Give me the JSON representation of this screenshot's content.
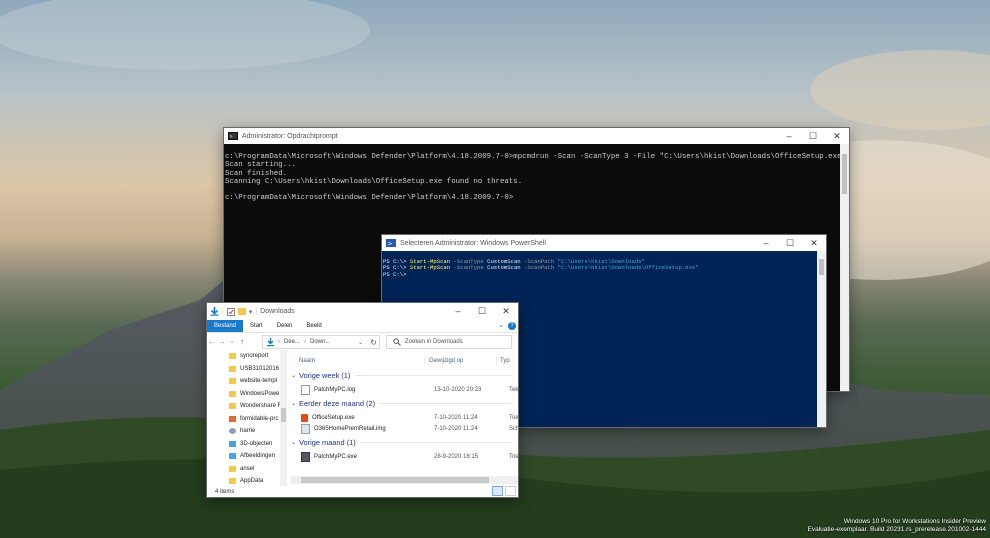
{
  "desktop": {
    "watermark_line1": "Windows 10 Pro for Workstations Insider Preview",
    "watermark_line2": "Evaluatie-exemplaar. Build 20231.rs_prerelease.201002-1444"
  },
  "cmd": {
    "title": "Administrator: Opdrachtprompt",
    "lines": [
      "c:\\ProgramData\\Microsoft\\Windows Defender\\Platform\\4.18.2009.7-0>mpcmdrun -Scan -ScanType 3 -File \"C:\\Users\\hkist\\Downloads\\OfficeSetup.exe\"",
      "Scan starting...",
      "Scan finished.",
      "Scanning C:\\Users\\hkist\\Downloads\\OfficeSetup.exe found no threats.",
      "",
      "c:\\ProgramData\\Microsoft\\Windows Defender\\Platform\\4.18.2009.7-0>"
    ]
  },
  "powershell": {
    "title": "Selecteren Administrator: Windows PowerShell",
    "prompt": "PS C:\\> ",
    "line1": {
      "cmd": "Start-MpScan",
      "p1": " -ScanType ",
      "v1": "CustomScan",
      "p2": " -ScanPath ",
      "path": "\"C:\\Users\\hkist\\Downloads\""
    },
    "line2": {
      "cmd": "Start-MpScan",
      "p1": " -ScanType ",
      "v1": "CustomScan",
      "p2": " -ScanPath ",
      "path": "\"C:\\Users\\hkist\\Downloads\\OfficeSetup.exe\""
    },
    "line3": "PS C:\\>"
  },
  "explorer": {
    "title": "Downloads",
    "ribbon_tabs": [
      "Bestand",
      "Start",
      "Delen",
      "Beeld"
    ],
    "address": [
      "Dee...",
      "Down..."
    ],
    "search_placeholder": "Zoeken in Downloads",
    "nav_items": [
      {
        "label": "synoreport",
        "icon": "folder-icon"
      },
      {
        "label": "USB31012016",
        "icon": "folder-icon"
      },
      {
        "label": "website-templ",
        "icon": "folder-icon"
      },
      {
        "label": "WindowsPowe",
        "icon": "folder-icon"
      },
      {
        "label": "Wondershare F",
        "icon": "folder-icon"
      },
      {
        "label": "formidable-prc",
        "icon": "file-icon"
      },
      {
        "label": "harrie",
        "icon": "user-icon"
      },
      {
        "label": "3D-objecten",
        "icon": "3d-objects-icon"
      },
      {
        "label": "Afbeeldingen",
        "icon": "pictures-icon"
      },
      {
        "label": "ansel",
        "icon": "folder-icon"
      },
      {
        "label": "AppData",
        "icon": "folder-icon"
      }
    ],
    "columns": {
      "name": "Naam",
      "modified": "Gewijzigd op",
      "type": "Typ"
    },
    "groups": [
      {
        "label": "Vorige week (1)",
        "files": [
          {
            "name": "PatchMyPC.log",
            "date": "13-10-2020 20:23",
            "type": "Teks",
            "icon": "text-file-icon"
          }
        ]
      },
      {
        "label": "Eerder deze maand (2)",
        "files": [
          {
            "name": "OfficeSetup.exe",
            "date": "7-10-2020 11:24",
            "type": "Toe",
            "icon": "office-icon"
          },
          {
            "name": "O365HomePremRetail.img",
            "date": "7-10-2020 11:24",
            "type": "Schi",
            "icon": "disc-image-icon"
          }
        ]
      },
      {
        "label": "Vorige maand (1)",
        "files": [
          {
            "name": "PatchMyPC.exe",
            "date": "28-9-2020 16:15",
            "type": "Toe",
            "icon": "app-icon"
          }
        ]
      }
    ],
    "status": "4 items"
  }
}
